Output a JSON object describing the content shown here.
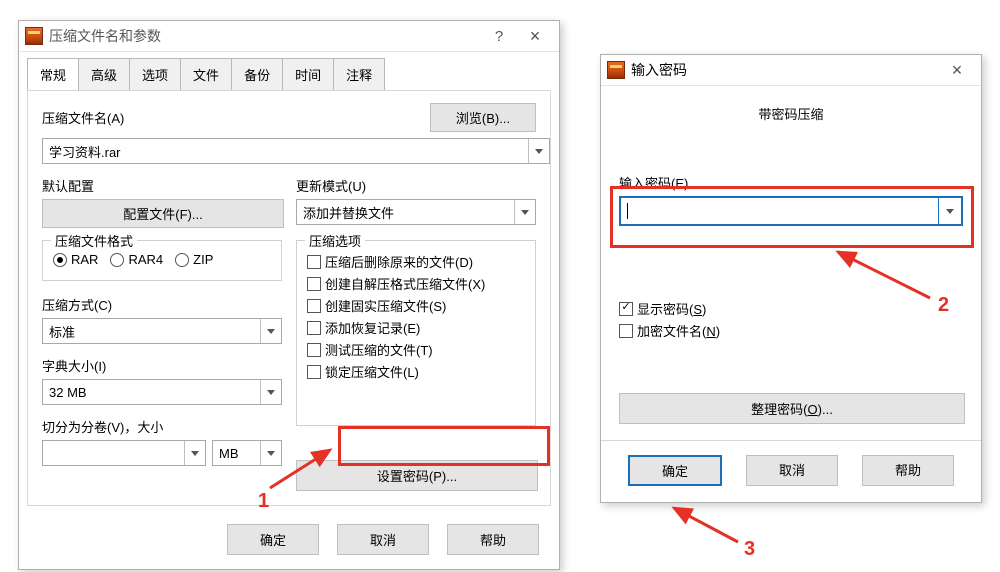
{
  "window1": {
    "title": "压缩文件名和参数",
    "help_btn": "?",
    "close_btn": "×",
    "tabs": [
      "常规",
      "高级",
      "选项",
      "文件",
      "备份",
      "时间",
      "注释"
    ],
    "archive_name_label": "压缩文件名(A)",
    "browse_btn": "浏览(B)...",
    "archive_name_value": "学习资料.rar",
    "default_profile_label": "默认配置",
    "profiles_btn": "配置文件(F)...",
    "update_mode_label": "更新模式(U)",
    "update_mode_value": "添加并替换文件",
    "format_group": "压缩文件格式",
    "formats": [
      "RAR",
      "RAR4",
      "ZIP"
    ],
    "method_label": "压缩方式(C)",
    "method_value": "标准",
    "dict_label": "字典大小(I)",
    "dict_value": "32 MB",
    "split_label": "切分为分卷(V)，大小",
    "split_unit": "MB",
    "options_group": "压缩选项",
    "options": [
      "压缩后删除原来的文件(D)",
      "创建自解压格式压缩文件(X)",
      "创建固实压缩文件(S)",
      "添加恢复记录(E)",
      "测试压缩的文件(T)",
      "锁定压缩文件(L)"
    ],
    "set_password_btn": "设置密码(P)...",
    "ok_btn": "确定",
    "cancel_btn": "取消",
    "help_btn2": "帮助"
  },
  "window2": {
    "title": "输入密码",
    "close_btn": "×",
    "heading": "带密码压缩",
    "password_label": "输入密码(E)",
    "show_pw_label_pre": "显示密码(",
    "show_pw_label_u": "S",
    "show_pw_label_post": ")",
    "encrypt_names_label_pre": "加密文件名(",
    "encrypt_names_label_u": "N",
    "encrypt_names_label_post": ")",
    "organize_btn_pre": "整理密码(",
    "organize_btn_u": "O",
    "organize_btn_post": ")...",
    "ok_btn": "确定",
    "cancel_btn": "取消",
    "help_btn": "帮助"
  },
  "annotations": {
    "n1": "1",
    "n2": "2",
    "n3": "3"
  }
}
